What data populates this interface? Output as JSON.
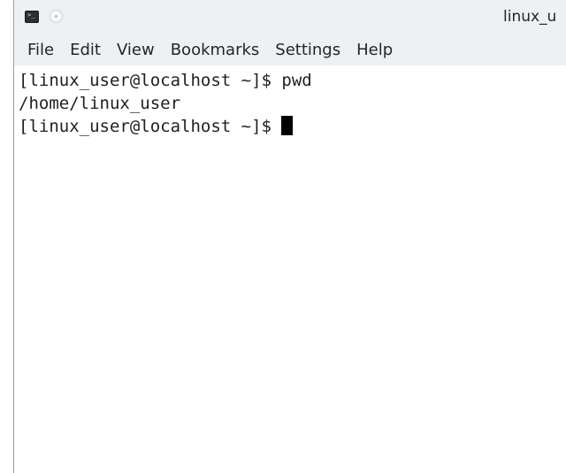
{
  "window": {
    "title": "linux_u"
  },
  "icons": {
    "app": "terminal-icon",
    "app_glyph": ">_",
    "minimize": "minimize-icon"
  },
  "menubar": {
    "items": [
      {
        "label": "File"
      },
      {
        "label": "Edit"
      },
      {
        "label": "View"
      },
      {
        "label": "Bookmarks"
      },
      {
        "label": "Settings"
      },
      {
        "label": "Help"
      }
    ]
  },
  "terminal": {
    "lines": [
      {
        "text": "[linux_user@localhost ~]$ pwd"
      },
      {
        "text": "/home/linux_user"
      }
    ],
    "current_prompt": "[linux_user@localhost ~]$ "
  },
  "colors": {
    "chrome": "#eff0f1",
    "background": "#ffffff",
    "text": "#1f1f1f",
    "cursor": "#000000"
  }
}
